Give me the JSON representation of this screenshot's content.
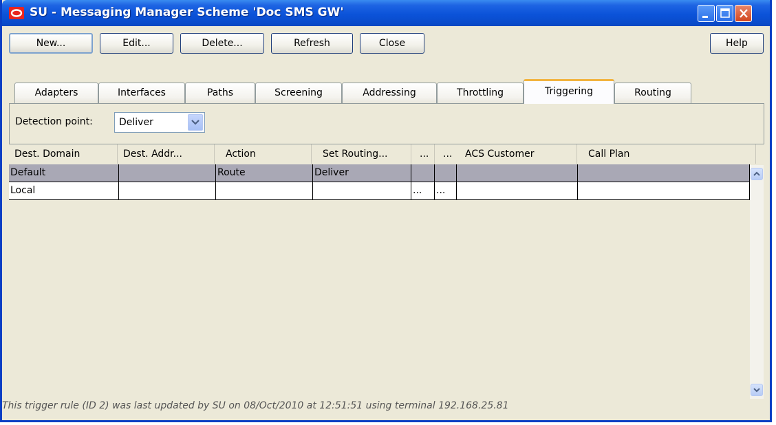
{
  "window": {
    "title": "SU - Messaging Manager Scheme 'Doc SMS GW'"
  },
  "toolbar": {
    "new_label": "New...",
    "edit_label": "Edit...",
    "delete_label": "Delete...",
    "refresh_label": "Refresh",
    "close_label": "Close",
    "help_label": "Help"
  },
  "tabs": [
    {
      "label": "Adapters"
    },
    {
      "label": "Interfaces"
    },
    {
      "label": "Paths"
    },
    {
      "label": "Screening"
    },
    {
      "label": "Addressing"
    },
    {
      "label": "Throttling"
    },
    {
      "label": "Triggering"
    },
    {
      "label": "Routing"
    }
  ],
  "active_tab": "Triggering",
  "detection_point": {
    "label": "Detection point:",
    "value": "Deliver"
  },
  "table": {
    "columns": [
      "Dest. Domain",
      "Dest. Addr...",
      "Action",
      "Set Routing...",
      "...",
      "...",
      "ACS Customer",
      "Call Plan"
    ],
    "rows": [
      {
        "selected": true,
        "cells": [
          "Default",
          "",
          "Route",
          "Deliver",
          "",
          "",
          "",
          ""
        ]
      },
      {
        "selected": false,
        "cells": [
          "Local",
          "",
          "",
          "",
          "...",
          "...",
          "",
          ""
        ]
      }
    ]
  },
  "status_text": "This trigger rule (ID 2) was last updated by SU on 08/Oct/2010 at 12:51:51 using terminal 192.168.25.81",
  "colors": {
    "title_bar": "#0b53d9",
    "active_tab_accent": "#f2b33e",
    "selected_row": "#a9a8b5",
    "window_bg": "#ece9d8"
  }
}
